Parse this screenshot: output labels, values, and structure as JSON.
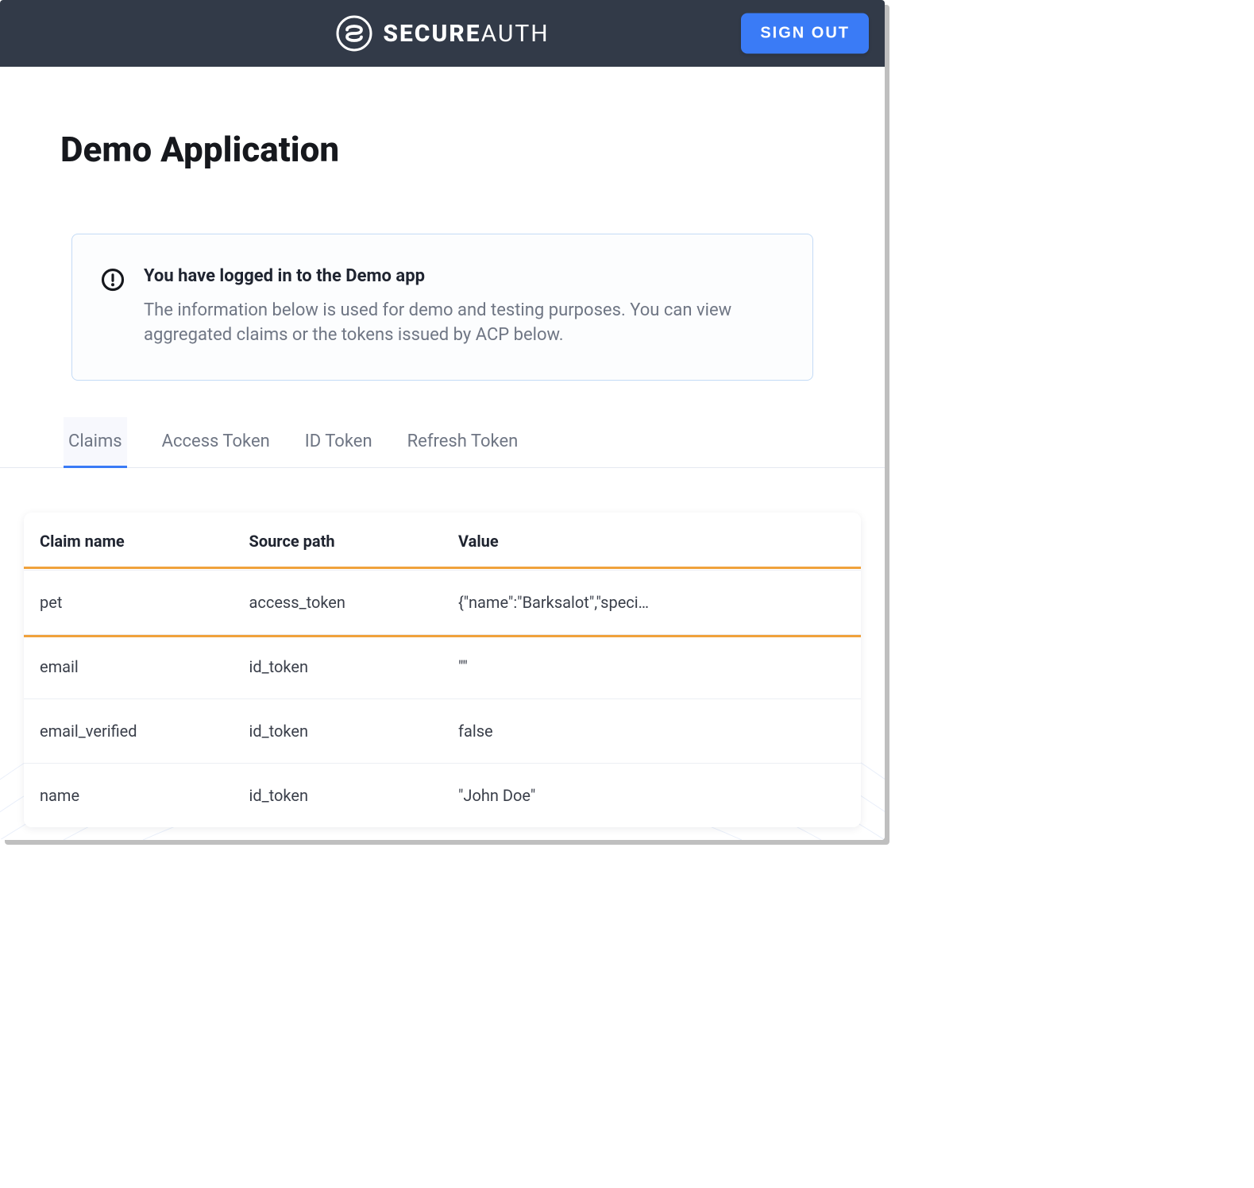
{
  "header": {
    "brand_bold": "SECURE",
    "brand_rest": "AUTH",
    "signout_label": "SIGN OUT"
  },
  "page": {
    "title": "Demo Application",
    "info_title": "You have logged in to the Demo app",
    "info_body": "The information below is used for demo and testing purposes. You can view aggregated claims or the tokens issued by ACP below."
  },
  "tabs": [
    {
      "id": "claims",
      "label": "Claims",
      "active": true
    },
    {
      "id": "access",
      "label": "Access Token",
      "active": false
    },
    {
      "id": "id",
      "label": "ID Token",
      "active": false
    },
    {
      "id": "refresh",
      "label": "Refresh Token",
      "active": false
    }
  ],
  "table": {
    "headers": [
      "Claim name",
      "Source path",
      "Value"
    ],
    "rows": [
      {
        "name": "pet",
        "source": "access_token",
        "value": "{\"name\":\"Barksalot\",\"speci…",
        "highlighted": true
      },
      {
        "name": "email",
        "source": "id_token",
        "value": "\"\""
      },
      {
        "name": "email_verified",
        "source": "id_token",
        "value": "false"
      },
      {
        "name": "name",
        "source": "id_token",
        "value": "\"John Doe\""
      }
    ]
  },
  "colors": {
    "accent": "#3a7bf6",
    "highlight": "#f0a23c"
  },
  "icons": {
    "logo": "secureauth-logo-icon",
    "alert": "alert-circle-icon"
  }
}
